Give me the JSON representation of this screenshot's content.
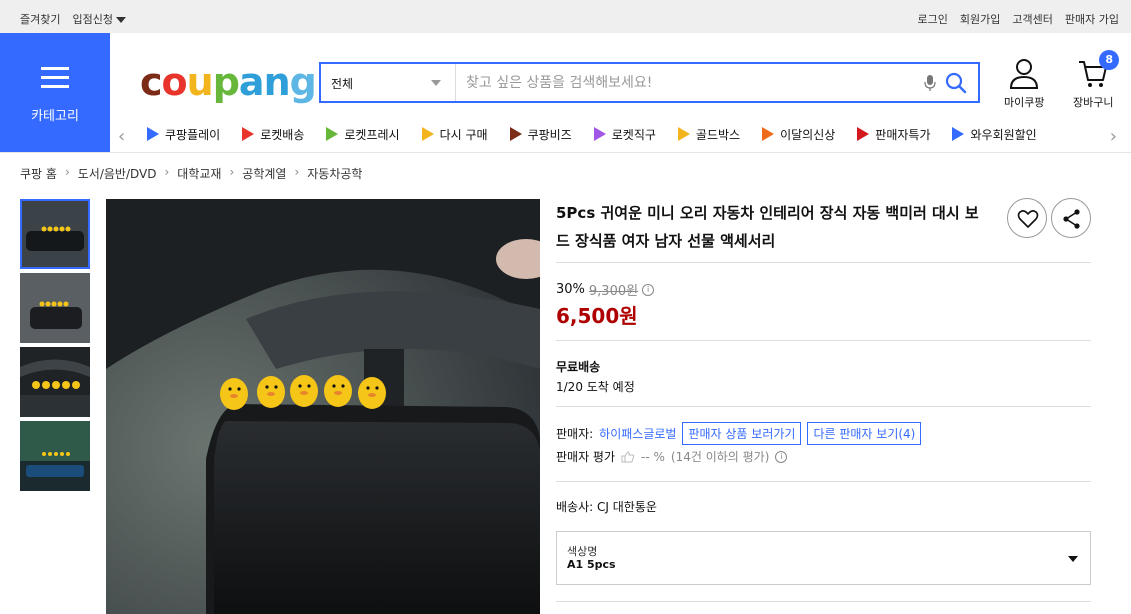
{
  "topbar": {
    "left": [
      "즐겨찾기",
      "입점신청"
    ],
    "right": [
      "로그인",
      "회원가입",
      "고객센터",
      "판매자 가입"
    ]
  },
  "header": {
    "category_label": "카테고리",
    "logo_letters": [
      "c",
      "o",
      "u",
      "p",
      "a",
      "n",
      "g"
    ],
    "search": {
      "category": "전체",
      "placeholder": "찾고 싶은 상품을 검색해보세요!"
    },
    "my_coupang": "마이쿠팡",
    "cart": "장바구니",
    "cart_count": "8"
  },
  "services": [
    {
      "label": "쿠팡플레이",
      "icon": "play-icon",
      "color": "#346aff"
    },
    {
      "label": "로켓배송",
      "icon": "rocket-icon",
      "color": "#e8342b"
    },
    {
      "label": "로켓프레시",
      "icon": "rocket-fresh-icon",
      "color": "#67b73b"
    },
    {
      "label": "다시 구매",
      "icon": "repurchase-icon",
      "color": "#f2b51d"
    },
    {
      "label": "쿠팡비즈",
      "icon": "biz-icon",
      "color": "#7b2b16"
    },
    {
      "label": "로켓직구",
      "icon": "rocket-global-icon",
      "color": "#a256e6"
    },
    {
      "label": "골드박스",
      "icon": "goldbox-icon",
      "color": "#f2b51d"
    },
    {
      "label": "이달의신상",
      "icon": "new-bag-icon",
      "color": "#f06a1b"
    },
    {
      "label": "판매자특가",
      "icon": "seller-deal-icon",
      "color": "#d3191e"
    },
    {
      "label": "와우회원할인",
      "icon": "wow-icon",
      "color": "#346aff"
    }
  ],
  "breadcrumb": [
    "쿠팡 홈",
    "도서/음반/DVD",
    "대학교재",
    "공학계열",
    "자동차공학"
  ],
  "product": {
    "title": "5Pcs 귀여운 미니 오리 자동차 인테리어 장식 자동 백미러 대시 보드 장식품 여자 남자 선물 액세서리",
    "discount": "30%",
    "original_price": "9,300원",
    "price": "6,500원",
    "shipping": "무료배송",
    "arrival": "1/20 도착 예정",
    "seller_label": "판매자:",
    "seller_name": "하이패스글로벌",
    "seller_products_btn": "판매자 상품 보러가기",
    "other_sellers_btn": "다른 판매자 보기(4)",
    "rating_label": "판매자 평가",
    "rating_value": "-- %",
    "rating_note": "(14건 이하의 평가)",
    "carrier_label": "배송사:",
    "carrier": "CJ 대한통운",
    "option_label": "색상명",
    "option_value": "A1 5pcs"
  },
  "colors": {
    "accent": "#346aff",
    "price": "#ae0000"
  }
}
